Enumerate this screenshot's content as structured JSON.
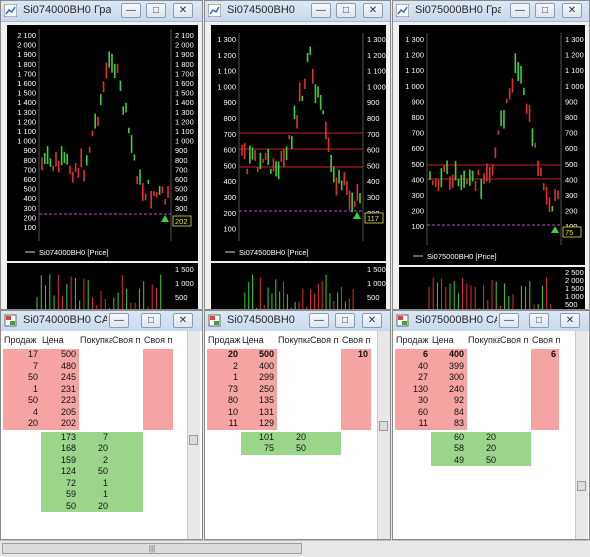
{
  "colors": {
    "sell": "#f6a3a3",
    "buy": "#9ad68a",
    "chart_bg": "#000000",
    "level_line": "#cc2222",
    "dash_line": "#cc44cc"
  },
  "charts": [
    {
      "title": "Si074000BH0 Гра",
      "legend": "Si074000BH0 [Price]",
      "left_ticks": [
        "2 100",
        "2 000",
        "1 900",
        "1 800",
        "1 700",
        "1 600",
        "1 500",
        "1 400",
        "1 300",
        "1 200",
        "1 100",
        "1 000",
        "900",
        "800",
        "700",
        "600",
        "500",
        "400",
        "300",
        "200",
        "100"
      ],
      "right_ticks": [
        "2 100",
        "2 000",
        "1 900",
        "1 800",
        "1 700",
        "1 600",
        "1 500",
        "1 400",
        "1 300",
        "1 200",
        "1 100",
        "1 000",
        "900",
        "800",
        "700",
        "600",
        "500",
        "400",
        "300"
      ],
      "price_box": "202",
      "lower_ticks": [
        "1 500",
        "1 000",
        "500"
      ]
    },
    {
      "title": "Si074500BH0",
      "legend": "Si074500BH0 [Price]",
      "left_ticks": [
        "1 300",
        "1 200",
        "1 100",
        "1 000",
        "900",
        "800",
        "700",
        "600",
        "500",
        "400",
        "300",
        "200",
        "100"
      ],
      "right_ticks": [
        "1 300",
        "1 200",
        "1 100",
        "1 000",
        "900",
        "800",
        "700",
        "600",
        "500",
        "400",
        "300",
        "200"
      ],
      "price_box": "117",
      "lower_ticks": [
        "1 500",
        "1 000",
        "500"
      ]
    },
    {
      "title": "Si075000BH0 Гра",
      "legend": "Si075000BH0 [Price]",
      "left_ticks": [
        "1 300",
        "1 200",
        "1 100",
        "1 000",
        "900",
        "800",
        "700",
        "600",
        "500",
        "400",
        "300",
        "200",
        "100"
      ],
      "right_ticks": [
        "1 300",
        "1 200",
        "1 100",
        "1 000",
        "900",
        "800",
        "700",
        "600",
        "500",
        "400",
        "300",
        "200",
        "100"
      ],
      "price_box": "75",
      "lower_ticks": [
        "2 500",
        "2 000",
        "1 500",
        "1 000",
        "500"
      ]
    }
  ],
  "ladders": [
    {
      "title": "Si074000BH0 CA",
      "headers": [
        "Продаж",
        "Цена",
        "Покупка",
        "Своя п",
        "Своя п"
      ],
      "sells": [
        [
          "17",
          "500"
        ],
        [
          "7",
          "480"
        ],
        [
          "50",
          "245"
        ],
        [
          "1",
          "231"
        ],
        [
          "50",
          "223"
        ],
        [
          "4",
          "205"
        ],
        [
          "20",
          "202"
        ]
      ],
      "buys": [
        [
          "173",
          "7"
        ],
        [
          "168",
          "20"
        ],
        [
          "159",
          "2"
        ],
        [
          "124",
          "50"
        ],
        [
          "72",
          "1"
        ],
        [
          "59",
          "1"
        ],
        [
          "50",
          "20"
        ]
      ],
      "own_sell": ""
    },
    {
      "title": "Si074500BH0",
      "headers": [
        "Продаж",
        "Цена",
        "Покупка",
        "Своя п",
        "Своя п"
      ],
      "sells": [
        [
          "20",
          "500"
        ],
        [
          "2",
          "400"
        ],
        [
          "1",
          "299"
        ],
        [
          "73",
          "250"
        ],
        [
          "80",
          "135"
        ],
        [
          "10",
          "131"
        ],
        [
          "11",
          "129"
        ]
      ],
      "buys": [
        [
          "101",
          "20"
        ],
        [
          "75",
          "50"
        ]
      ],
      "own_sell": "10"
    },
    {
      "title": "Si075000BH0 CA",
      "headers": [
        "Продаж",
        "Цена",
        "Покупка",
        "Своя п",
        "Своя п"
      ],
      "sells": [
        [
          "6",
          "400"
        ],
        [
          "40",
          "399"
        ],
        [
          "27",
          "300"
        ],
        [
          "130",
          "240"
        ],
        [
          "30",
          "92"
        ],
        [
          "60",
          "84"
        ],
        [
          "11",
          "83"
        ]
      ],
      "buys": [
        [
          "60",
          "20"
        ],
        [
          "58",
          "20"
        ],
        [
          "49",
          "50"
        ]
      ],
      "own_sell": "6"
    }
  ],
  "bottom_scroll_grip": "|||"
}
